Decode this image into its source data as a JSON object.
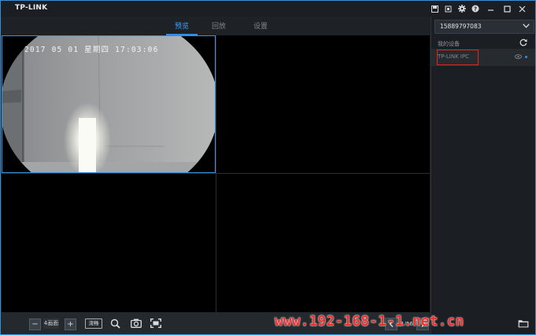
{
  "app": {
    "logo": "TP-LINK"
  },
  "title_bar": {
    "icons": [
      "window-save-icon",
      "network-icon",
      "gear-icon",
      "help-icon",
      "minimize-icon",
      "maximize-icon",
      "close-icon"
    ]
  },
  "tabs": [
    {
      "label": "预览",
      "active": true
    },
    {
      "label": "回放",
      "active": false
    },
    {
      "label": "设置",
      "active": false
    }
  ],
  "video": {
    "osd_timestamp": "2017 05 01 星期四 17:03:06",
    "cells": 4
  },
  "toolbar": {
    "minus": "−",
    "layout_label": "4画面",
    "plus": "+",
    "stream_label": "流畅",
    "page": "1/16"
  },
  "panel": {
    "account": "15889797083",
    "my_devices_label": "我的设备",
    "devices": [
      {
        "name": "TP-LINK IPC",
        "online": true
      }
    ]
  },
  "watermark": "www.192-168-1-1.net.cn",
  "colors": {
    "accent": "#2f8fe6",
    "highlight": "#e22424",
    "watermark": "#e8322f"
  }
}
